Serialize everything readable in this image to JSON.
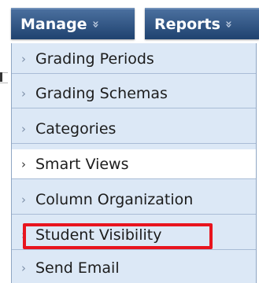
{
  "tabs": {
    "manage": {
      "label": "Manage",
      "chevron": "»"
    },
    "reports": {
      "label": "Reports",
      "chevron": "»"
    }
  },
  "menu": {
    "items": [
      {
        "label": "Grading Periods",
        "arrow": "›"
      },
      {
        "label": "Grading Schemas",
        "arrow": "›"
      },
      {
        "label": "Categories",
        "arrow": "›"
      },
      {
        "label": "Smart Views",
        "arrow": "›"
      },
      {
        "label": "Column Organization",
        "arrow": "›"
      },
      {
        "label": "Student Visibility",
        "arrow": "›"
      },
      {
        "label": "Send Email",
        "arrow": "›"
      }
    ]
  },
  "colors": {
    "tab_gradient_top": "#4a6f9e",
    "tab_gradient_bottom": "#1f426f",
    "menu_bg": "#dce8f6",
    "hover_bg": "#ffffff",
    "highlight_border": "#e8141e"
  }
}
